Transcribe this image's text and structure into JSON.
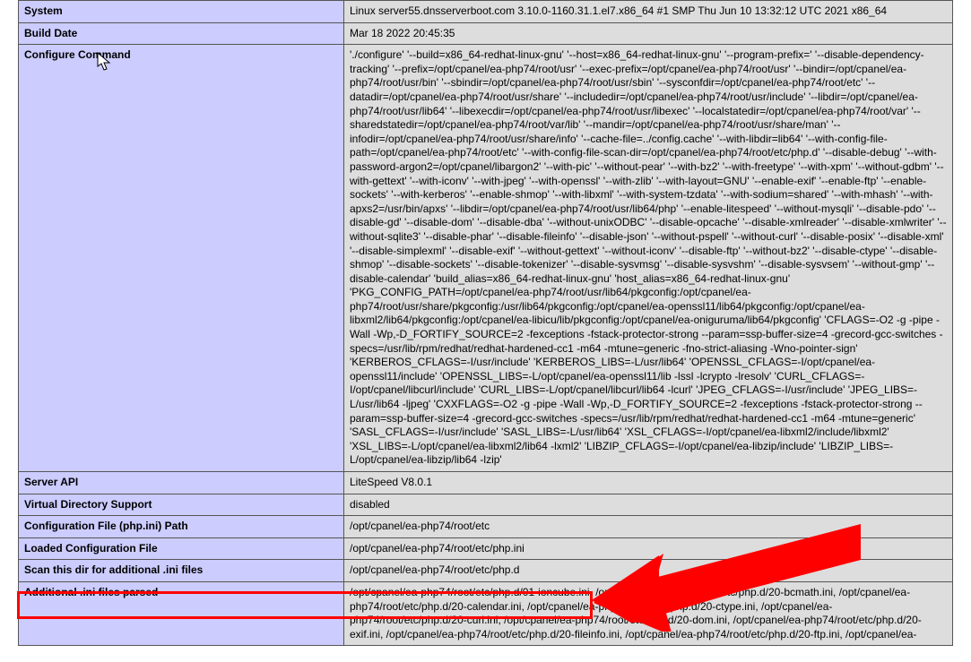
{
  "rows": {
    "system": {
      "label": "System",
      "value": "Linux server55.dnsserverboot.com 3.10.0-1160.31.1.el7.x86_64 #1 SMP Thu Jun 10 13:32:12 UTC 2021 x86_64"
    },
    "build_date": {
      "label": "Build Date",
      "value": "Mar 18 2022 20:45:35"
    },
    "configure": {
      "label": "Configure Command",
      "value": "'./configure' '--build=x86_64-redhat-linux-gnu' '--host=x86_64-redhat-linux-gnu' '--program-prefix=' '--disable-dependency-tracking' '--prefix=/opt/cpanel/ea-php74/root/usr' '--exec-prefix=/opt/cpanel/ea-php74/root/usr' '--bindir=/opt/cpanel/ea-php74/root/usr/bin' '--sbindir=/opt/cpanel/ea-php74/root/usr/sbin' '--sysconfdir=/opt/cpanel/ea-php74/root/etc' '--datadir=/opt/cpanel/ea-php74/root/usr/share' '--includedir=/opt/cpanel/ea-php74/root/usr/include' '--libdir=/opt/cpanel/ea-php74/root/usr/lib64' '--libexecdir=/opt/cpanel/ea-php74/root/usr/libexec' '--localstatedir=/opt/cpanel/ea-php74/root/var' '--sharedstatedir=/opt/cpanel/ea-php74/root/var/lib' '--mandir=/opt/cpanel/ea-php74/root/usr/share/man' '--infodir=/opt/cpanel/ea-php74/root/usr/share/info' '--cache-file=../config.cache' '--with-libdir=lib64' '--with-config-file-path=/opt/cpanel/ea-php74/root/etc' '--with-config-file-scan-dir=/opt/cpanel/ea-php74/root/etc/php.d' '--disable-debug' '--with-password-argon2=/opt/cpanel/libargon2' '--with-pic' '--without-pear' '--with-bz2' '--with-freetype' '--with-xpm' '--without-gdbm' '--with-gettext' '--with-iconv' '--with-jpeg' '--with-openssl' '--with-zlib' '--with-layout=GNU' '--enable-exif' '--enable-ftp' '--enable-sockets' '--with-kerberos' '--enable-shmop' '--with-libxml' '--with-system-tzdata' '--with-sodium=shared' '--with-mhash' '--with-apxs2=/usr/bin/apxs' '--libdir=/opt/cpanel/ea-php74/root/usr/lib64/php' '--enable-litespeed' '--without-mysqli' '--disable-pdo' '--disable-gd' '--disable-dom' '--disable-dba' '--without-unixODBC' '--disable-opcache' '--disable-xmlreader' '--disable-xmlwriter' '--without-sqlite3' '--disable-phar' '--disable-fileinfo' '--disable-json' '--without-pspell' '--without-curl' '--disable-posix' '--disable-xml' '--disable-simplexml' '--disable-exif' '--without-gettext' '--without-iconv' '--disable-ftp' '--without-bz2' '--disable-ctype' '--disable-shmop' '--disable-sockets' '--disable-tokenizer' '--disable-sysvmsg' '--disable-sysvshm' '--disable-sysvsem' '--without-gmp' '--disable-calendar' 'build_alias=x86_64-redhat-linux-gnu' 'host_alias=x86_64-redhat-linux-gnu' 'PKG_CONFIG_PATH=/opt/cpanel/ea-php74/root/usr/lib64/pkgconfig:/opt/cpanel/ea-php74/root/usr/share/pkgconfig:/usr/lib64/pkgconfig:/opt/cpanel/ea-openssl11/lib64/pkgconfig:/opt/cpanel/ea-libxml2/lib64/pkgconfig:/opt/cpanel/ea-libicu/lib/pkgconfig:/opt/cpanel/ea-oniguruma/lib64/pkgconfig' 'CFLAGS=-O2 -g -pipe -Wall -Wp,-D_FORTIFY_SOURCE=2 -fexceptions -fstack-protector-strong --param=ssp-buffer-size=4 -grecord-gcc-switches -specs=/usr/lib/rpm/redhat/redhat-hardened-cc1 -m64 -mtune=generic -fno-strict-aliasing -Wno-pointer-sign' 'KERBEROS_CFLAGS=-I/usr/include' 'KERBEROS_LIBS=-L/usr/lib64' 'OPENSSL_CFLAGS=-I/opt/cpanel/ea-openssl11/include' 'OPENSSL_LIBS=-L/opt/cpanel/ea-openssl11/lib -lssl -lcrypto -lresolv' 'CURL_CFLAGS=-I/opt/cpanel/libcurl/include' 'CURL_LIBS=-L/opt/cpanel/libcurl/lib64 -lcurl' 'JPEG_CFLAGS=-I/usr/include' 'JPEG_LIBS=-L/usr/lib64 -ljpeg' 'CXXFLAGS=-O2 -g -pipe -Wall -Wp,-D_FORTIFY_SOURCE=2 -fexceptions -fstack-protector-strong --param=ssp-buffer-size=4 -grecord-gcc-switches -specs=/usr/lib/rpm/redhat/redhat-hardened-cc1 -m64 -mtune=generic' 'SASL_CFLAGS=-I/usr/include' 'SASL_LIBS=-L/usr/lib64' 'XSL_CFLAGS=-I/opt/cpanel/ea-libxml2/include/libxml2' 'XSL_LIBS=-L/opt/cpanel/ea-libxml2/lib64 -lxml2' 'LIBZIP_CFLAGS=-I/opt/cpanel/ea-libzip/include' 'LIBZIP_LIBS=-L/opt/cpanel/ea-libzip/lib64 -lzip'"
    },
    "server_api": {
      "label": "Server API",
      "value": "LiteSpeed V8.0.1"
    },
    "vdir": {
      "label": "Virtual Directory Support",
      "value": "disabled"
    },
    "config_path": {
      "label": "Configuration File (php.ini) Path",
      "value": "/opt/cpanel/ea-php74/root/etc"
    },
    "loaded_config": {
      "label": "Loaded Configuration File",
      "value": "/opt/cpanel/ea-php74/root/etc/php.ini"
    },
    "scan_dir": {
      "label": "Scan this dir for additional .ini files",
      "value": "/opt/cpanel/ea-php74/root/etc/php.d"
    },
    "additional_ini": {
      "label": "Additional .ini files parsed",
      "value": "/opt/cpanel/ea-php74/root/etc/php.d/01-ioncube.ini, /opt/cpanel/ea-php74/root/etc/php.d/20-bcmath.ini, /opt/cpanel/ea-php74/root/etc/php.d/20-calendar.ini, /opt/cpanel/ea-php74/root/etc/php.d/20-ctype.ini, /opt/cpanel/ea-php74/root/etc/php.d/20-curl.ini, /opt/cpanel/ea-php74/root/etc/php.d/20-dom.ini, /opt/cpanel/ea-php74/root/etc/php.d/20-exif.ini, /opt/cpanel/ea-php74/root/etc/php.d/20-fileinfo.ini, /opt/cpanel/ea-php74/root/etc/php.d/20-ftp.ini, /opt/cpanel/ea-"
    }
  }
}
